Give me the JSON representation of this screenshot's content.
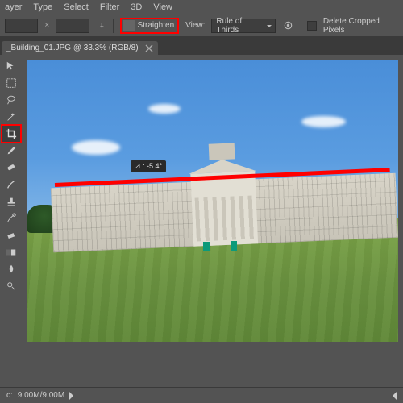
{
  "menu": {
    "items": [
      "ayer",
      "Type",
      "Select",
      "Filter",
      "3D",
      "View"
    ]
  },
  "options": {
    "straighten_label": "Straighten",
    "view_label": "View:",
    "overlay": "Rule of Thirds",
    "delete_cropped_label": "Delete Cropped Pixels"
  },
  "tab": {
    "title": "_Building_01.JPG @ 33.3% (RGB/8)"
  },
  "canvas": {
    "angle_label": "⊿ : -5.4°"
  },
  "status": {
    "doc_label": "c:",
    "doc_size": "9.00M/9.00M"
  }
}
